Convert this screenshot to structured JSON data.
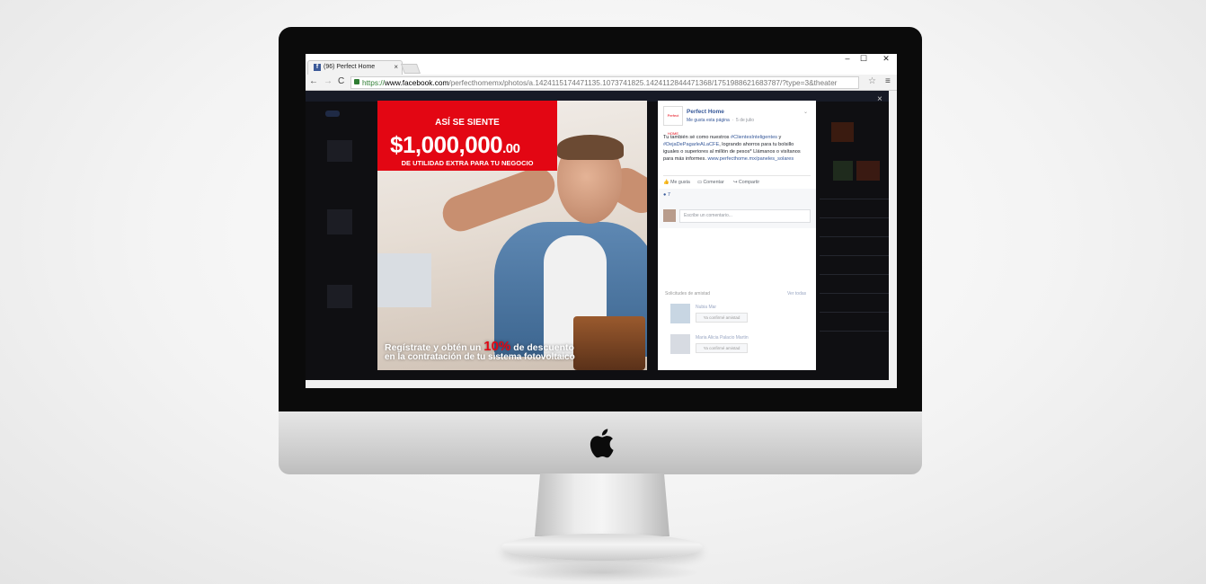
{
  "browser": {
    "tab_title": "(96) Perfect Home",
    "tab_close": "×",
    "window_controls": [
      "–",
      "☐",
      "✕"
    ],
    "nav": {
      "back": "←",
      "forward": "→",
      "reload": "C"
    },
    "url": {
      "scheme": "https://",
      "host": "www.facebook.com",
      "path": "/perfecthomemx/photos/a.1424115174471135.1073741825.1424112844471368/1751988621683787/?type=3&theater"
    },
    "star": "☆",
    "menu": "≡",
    "theater_close": "×"
  },
  "ad": {
    "headline": "ASÍ SE SIENTE",
    "amount_main": "$1,000,000",
    "amount_cents": ".00",
    "subline": "DE UTILIDAD EXTRA PARA TU NEGOCIO",
    "bottom_line1_pre": "Regístrate y obtén un ",
    "bottom_pct": "10%",
    "bottom_line1_post": " de descuento",
    "bottom_line2": "en la contratación de tu sistema fotovoltaico"
  },
  "post": {
    "logo_text": "Perfect HOME",
    "page_name": "Perfect Home",
    "like_page": "Me gusta esta página",
    "date": "5 de julio",
    "text_pre": "Tu también sé como nuestros ",
    "hashtag1": "#ClientesInteligentes",
    "text_mid1": " y ",
    "hashtag2": "#DejaDePagarleALaCFE",
    "text_mid2": ", logrando ahorros para tu bolsillo iguales o superiores al millón de pesos* Llámanos o visítanos para más informes. ",
    "link": "www.perfecthome.mx/paneles_solares",
    "actions": [
      "Me gusta",
      "Comentar",
      "Compartir"
    ],
    "reactions_count": "7",
    "comment_placeholder": "Escribe un comentario...",
    "suggestions_header": "Solicitudes de amistad",
    "suggestions_all": "Ver todas",
    "suggestions": [
      {
        "name": "Nubia Mar",
        "button": "Ya confirmé amistad"
      },
      {
        "name": "Maria Alicia Palacio Martin",
        "button": "Ya confirmé amistad"
      }
    ]
  }
}
